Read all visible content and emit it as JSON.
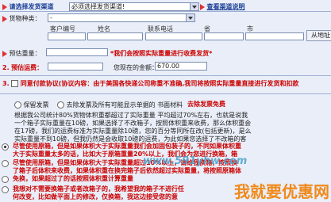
{
  "shipping": {
    "label": "请选择发货渠道",
    "select_value": "必须选择发货渠道!",
    "link": "查看渠道说明"
  },
  "cargo": {
    "label": "货物种类：",
    "select_value": "-"
  },
  "columns": [
    "客户编号",
    "姓名",
    "联系电话",
    "省",
    "市"
  ],
  "add_button": "从地址",
  "estimate_weight": {
    "label": "预估重量：",
    "note": "*我们会按照实际重量进行收费发货*"
  },
  "estimate_freight": {
    "label": "预估运费：",
    "total_label": "您现在的金额：",
    "total_value": "670.00"
  },
  "agreement": {
    "number": "3.",
    "text": "同意付款协议(协议内容：由于美国各快递公司称重不准确,我司将按照实际重量直接进行发货和扣款"
  },
  "invoice": {
    "keep_label": "保留发票",
    "remove_label": "去除发票及所有可能显示单据的 书面材料",
    "remove_note": "去除发票免费"
  },
  "paragraph": "根据我公司统计80%货物体积重都超过了实际重量 平均超过70%左右，也就是说我一个箱子实际重量在10磅，如果选择了不改箱子，按照体积重来收费，那么体积重会在17磅，我们的运费标准为实际重量除10磅，您的百分等同所在改(包括更新)，是么实际重量不到10磅，但我仍然是会收取10磅的运费，为此如果您选择了不改箱的客户，请提前先做好计算",
  "option1": "尽管使用原箱，但是如果体积大于实际重量我们会加固包装子的，不同如果体积重大于实际重量太多的话，比如大于原箱重量20%以上，我们会为您进行换箱，箱子不一定是完整，但会包装稳妥，直接发货",
  "option2": "尽管使用原箱，但是如果体积大于实际重量超过10%以上，请给我换箱，按照换了箱子后体积来收费，如果体积重在换完箱子后依然超过实际重量，将按照原箱体积来收费",
  "option3": "免换，如果超过了的话按照体积重计算重量",
  "option4": "我想对不需要换箱子或者改箱子的，我希望我的箱子不进行任何改变，比如做平面上的修改，仅换箱，我这边接受您的意见，有问题不要怪我",
  "watermark": {
    "site": "www.591yhw.com",
    "cn": "我就要优惠网"
  }
}
